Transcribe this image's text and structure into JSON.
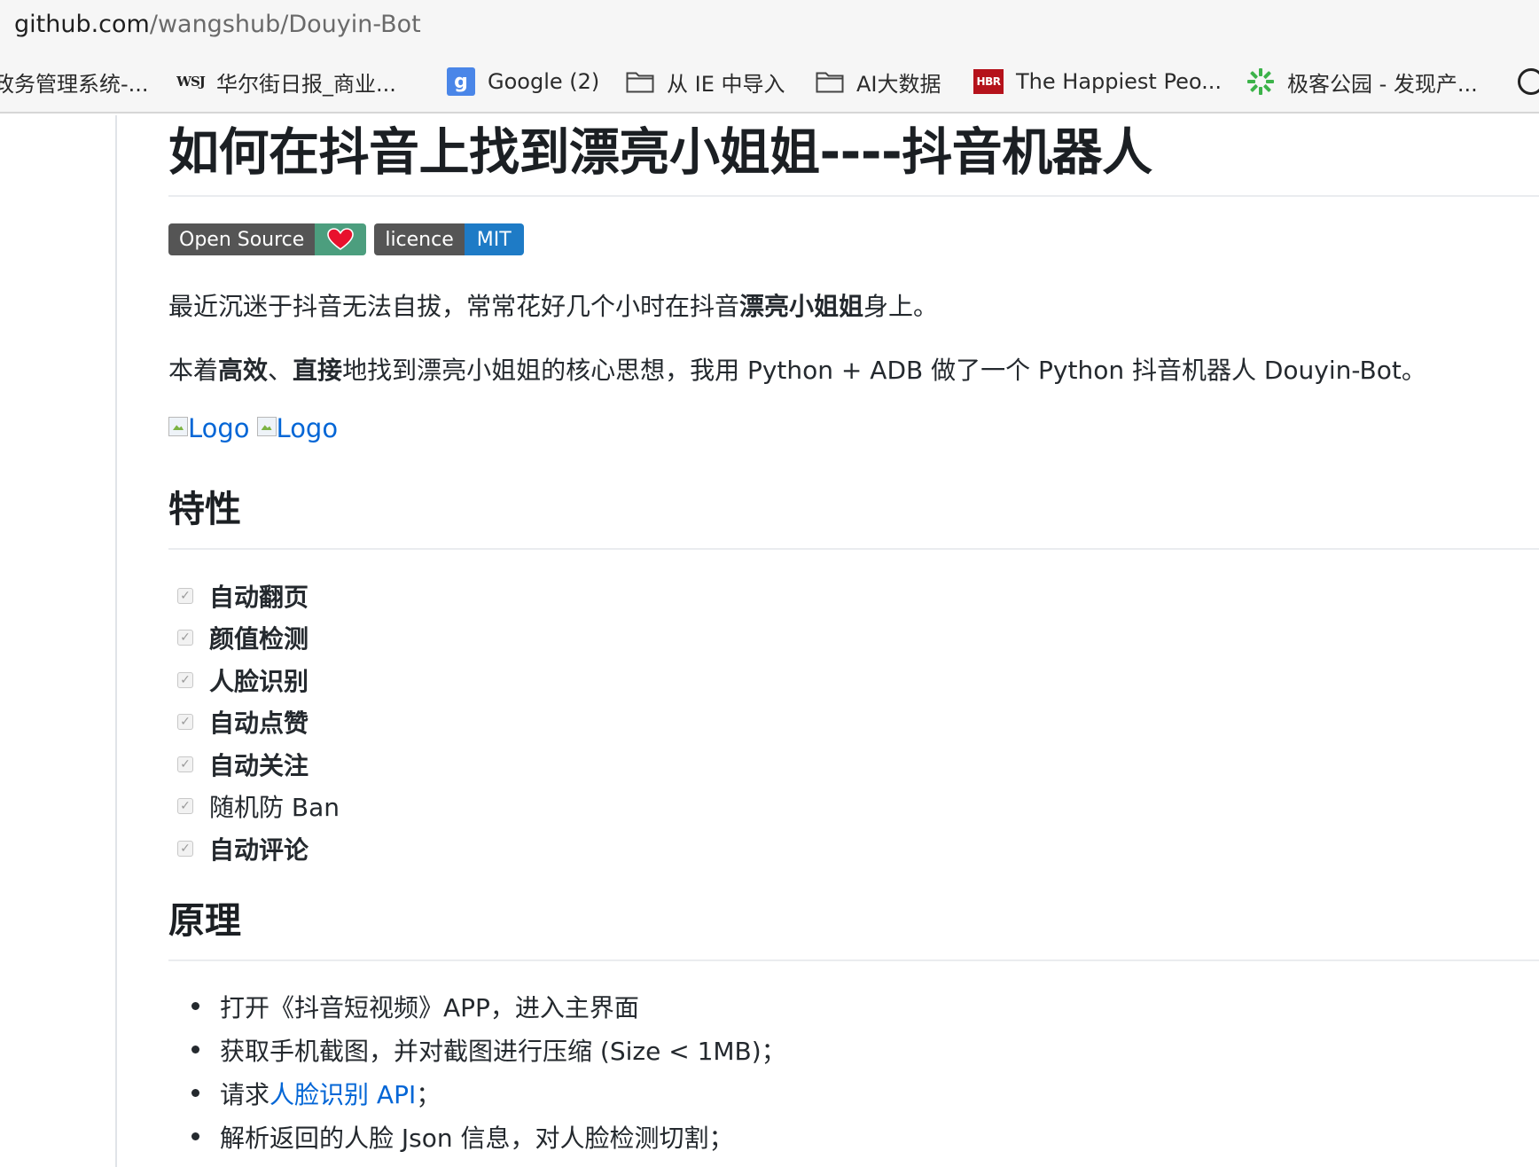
{
  "browser": {
    "url_host": "github.com",
    "url_path": "/wangshub/Douyin-Bot",
    "bookmarks": [
      {
        "label": "政务管理系统-...",
        "icon": "none"
      },
      {
        "label": "华尔街日报_商业...",
        "icon": "wsj-icon",
        "icon_text": "WSJ"
      },
      {
        "label": "Google (2)",
        "icon": "google-icon",
        "icon_text": "g"
      },
      {
        "label": "从 IE 中导入",
        "icon": "folder-icon"
      },
      {
        "label": "AI大数据",
        "icon": "folder-icon"
      },
      {
        "label": "The Happiest Peo...",
        "icon": "hbr-icon",
        "icon_text": "HBR"
      },
      {
        "label": "极客公园 - 发现产...",
        "icon": "geekpark-icon"
      }
    ]
  },
  "readme": {
    "title": "如何在抖音上找到漂亮小姐姐----抖音机器人",
    "badges": [
      {
        "left": "Open Source",
        "right_icon": "heart-icon",
        "right_color": "#4c9e7e"
      },
      {
        "left": "licence",
        "right": "MIT",
        "right_color": "#1e7bc6"
      }
    ],
    "intro1": {
      "before": "最近沉迷于抖音无法自拔，常常花好几个小时在抖音",
      "bold": "漂亮小姐姐",
      "after": "身上。"
    },
    "intro2": {
      "before": "本着",
      "bold1": "高效",
      "sep": "、",
      "bold2": "直接",
      "after": "地找到漂亮小姐姐的核心思想，我用 Python + ADB 做了一个 Python 抖音机器人 Douyin-Bot。"
    },
    "logos": [
      "Logo",
      "Logo"
    ],
    "features_heading": "特性",
    "features": [
      {
        "label": "自动翻页",
        "bold": true
      },
      {
        "label": "颜值检测",
        "bold": true
      },
      {
        "label": "人脸识别",
        "bold": true
      },
      {
        "label": "自动点赞",
        "bold": true
      },
      {
        "label": "自动关注",
        "bold": true
      },
      {
        "label": "随机防 Ban",
        "bold": false
      },
      {
        "label": "自动评论",
        "bold": true
      }
    ],
    "principle_heading": "原理",
    "principle": {
      "b1": "打开《抖音短视频》APP，进入主界面",
      "b2": "获取手机截图，并对截图进行压缩 (Size < 1MB)；",
      "b3_before": "请求 ",
      "b3_link": "人脸识别 API",
      "b3_after": "；",
      "b4": "解析返回的人脸 Json 信息，对人脸检测切割；"
    }
  }
}
